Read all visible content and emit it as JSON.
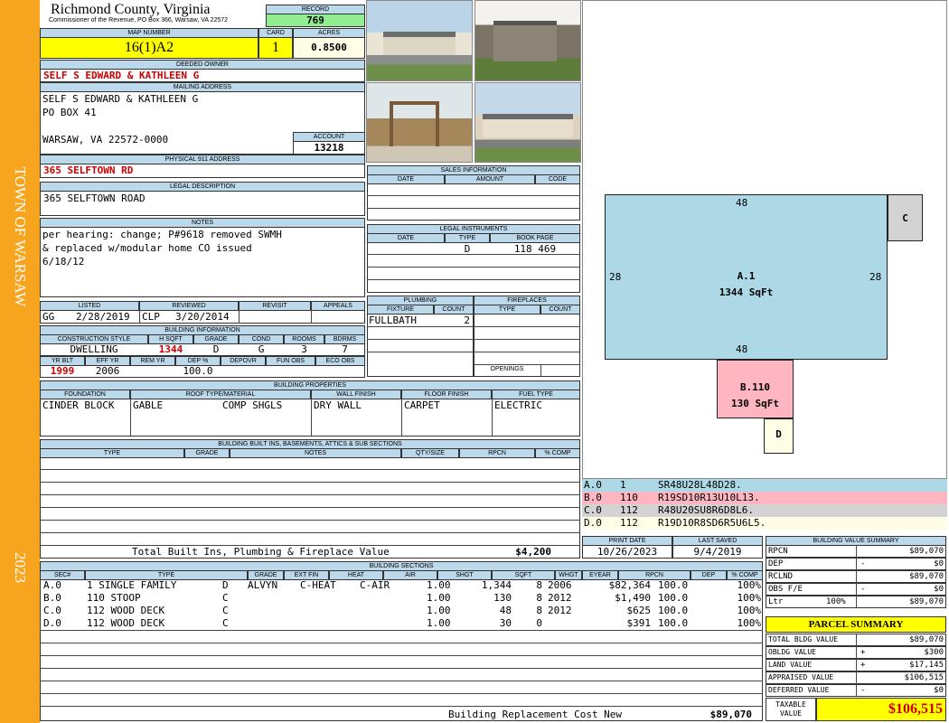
{
  "sidebar": {
    "town": "TOWN OF WARSAW",
    "year": "2023"
  },
  "header": {
    "county": "Richmond County, Virginia",
    "commissioner": "Commissioner of the Revenue, PO Box 366, Warsaw, VA 22572",
    "record_label": "RECORD",
    "record": "769",
    "map_label": "MAP NUMBER",
    "map_number": "16(1)A2",
    "card_label": "CARD",
    "card": "1",
    "acres_label": "ACRES",
    "acres": "0.8500"
  },
  "owner": {
    "deeded_label": "DEEDED OWNER",
    "deeded_owner": "SELF S EDWARD & KATHLEEN G",
    "mailing_label": "MAILING ADDRESS",
    "mail_line1": "SELF S EDWARD & KATHLEEN G",
    "mail_line2": "PO BOX 41",
    "mail_line3": "WARSAW, VA 22572-0000",
    "account_label": "ACCOUNT",
    "account": "13218",
    "physical_label": "PHYSICAL 911 ADDRESS",
    "physical_address": "365 SELFTOWN RD",
    "legal_label": "LEGAL DESCRIPTION",
    "legal_description": "365 SELFTOWN ROAD",
    "notes_label": "NOTES",
    "notes_line1": "per hearing: change; P#9618 removed SWMH",
    "notes_line2": "& replaced w/modular home CO issued",
    "notes_line3": "6/18/12"
  },
  "review": {
    "listed_label": "LISTED",
    "reviewed_label": "REVIEWED",
    "revisit_label": "REVISIT",
    "appeals_label": "APPEALS",
    "listed_by": "GG",
    "listed_date": "2/28/2019",
    "reviewed_by": "CLP",
    "reviewed_date": "3/20/2014"
  },
  "building_info": {
    "title": "BUILDING INFORMATION",
    "h_construction": "CONSTRUCTION STYLE",
    "h_sqft": "H SQFT",
    "h_grade": "GRADE",
    "h_cond": "COND",
    "h_rooms": "ROOMS",
    "h_bdrms": "BDRMS",
    "construction": "DWELLING",
    "sqft": "1344",
    "grade": "D",
    "cond": "G",
    "rooms": "3",
    "bdrms": "7",
    "h_yrblt": "YR BLT",
    "h_effyr": "EFF YR",
    "h_remyr": "REM YR",
    "h_dep": "DEP %",
    "h_depovr": "DEPOVR",
    "h_funobs": "FUN OBS",
    "h_ecoobs": "ECO OBS",
    "yr_blt": "1999",
    "eff_yr": "2006",
    "dep": "100.0"
  },
  "sales": {
    "title": "SALES INFORMATION",
    "h_date": "DATE",
    "h_amount": "AMOUNT",
    "h_code": "CODE"
  },
  "legal_instruments": {
    "title": "LEGAL INSTRUMENTS",
    "h_date": "DATE",
    "h_type": "TYPE",
    "h_book": "BOOK PAGE",
    "type": "D",
    "book_page": "118  469"
  },
  "plumbing": {
    "title": "PLUMBING",
    "h_fixture": "FIXTURE",
    "h_count": "COUNT",
    "fixture": "FULLBATH",
    "count": "2"
  },
  "fireplaces": {
    "title": "FIREPLACES",
    "h_type": "TYPE",
    "h_count": "COUNT",
    "openings": "OPENINGS"
  },
  "properties": {
    "title": "BUILDING PROPERTIES",
    "h_foundation": "FOUNDATION",
    "h_roof": "ROOF TYPE/MATERIAL",
    "h_wall": "WALL FINISH",
    "h_floor": "FLOOR FINISH",
    "h_fuel": "FUEL TYPE",
    "foundation": "CINDER BLOCK",
    "roof_type": "GABLE",
    "roof_material": "COMP SHGLS",
    "wall": "DRY WALL",
    "floor": "CARPET",
    "fuel": "ELECTRIC"
  },
  "builtins": {
    "title": "BUILDING BUILT INS, BASEMENTS, ATTICS & SUB SECTIONS",
    "h_type": "TYPE",
    "h_grade": "GRADE",
    "h_notes": "NOTES",
    "h_qty": "QTY/SIZE",
    "h_rpcn": "RPCN",
    "h_comp": "% COMP",
    "total_label": "Total Built Ins, Plumbing & Fireplace Value",
    "total": "$4,200"
  },
  "print": {
    "h_print": "PRINT DATE",
    "h_saved": "LAST SAVED",
    "print_date": "10/26/2023",
    "last_saved": "9/4/2019"
  },
  "sections": {
    "title": "BUILDING SECTIONS",
    "headers": [
      "SEC#",
      "TYPE",
      "GRADE",
      "EXT FIN",
      "HEAT",
      "AIR",
      "SHGT",
      "SQFT",
      "WHGT",
      "EYEAR",
      "RPCN",
      "DEP",
      "% COMP"
    ],
    "rows": [
      [
        "A.0",
        "1 SINGLE FAMILY",
        "D",
        "ALVYN",
        "C-HEAT",
        "C-AIR",
        "1.00",
        "1,344",
        "8",
        "2006",
        "$82,364",
        "100.0",
        "100%"
      ],
      [
        "B.0",
        "110 STOOP",
        "C",
        "",
        "",
        "",
        "1.00",
        "130",
        "8",
        "2012",
        "$1,490",
        "100.0",
        "100%"
      ],
      [
        "C.0",
        "112 WOOD DECK",
        "C",
        "",
        "",
        "",
        "1.00",
        "48",
        "8",
        "2012",
        "$625",
        "100.0",
        "100%"
      ],
      [
        "D.0",
        "112 WOOD DECK",
        "C",
        "",
        "",
        "",
        "1.00",
        "30",
        "0",
        "",
        "$391",
        "100.0",
        "100%"
      ]
    ],
    "replacement_label": "Building Replacement Cost New",
    "replacement": "$89,070"
  },
  "sketch": {
    "a_label": "A.1",
    "a_area": "1344 SqFt",
    "a_top": "48",
    "a_bottom": "48",
    "a_left": "28",
    "a_right": "28",
    "b_label": "B.110",
    "b_area": "130 SqFt",
    "c_label": "C",
    "d_label": "D",
    "colors": {
      "a": "#add8e6",
      "b": "#ffb6c1",
      "c": "#d3d3d3",
      "d": "#fffde6"
    },
    "legend": [
      {
        "sec": "A.0",
        "code": "1",
        "path": "SR48U28L48D28."
      },
      {
        "sec": "B.0",
        "code": "110",
        "path": "R19SD10R13U10L13."
      },
      {
        "sec": "C.0",
        "code": "112",
        "path": "R48U20SU8R6D8L6."
      },
      {
        "sec": "D.0",
        "code": "112",
        "path": "R19D10R8SD6R5U6L5."
      }
    ]
  },
  "bvs": {
    "title": "BUILDING VALUE SUMMARY",
    "rpcn_label": "RPCN",
    "rpcn": "$89,070",
    "dep_label": "DEP",
    "dep_sign": "-",
    "dep": "$0",
    "rclnd_label": "RCLND",
    "rclnd": "$89,070",
    "obs_label": "OBS F/E",
    "obs_sign": "-",
    "obs": "$0",
    "ltr_label": "Ltr",
    "ltr_pct": "100%",
    "ltr": "$89,070"
  },
  "parcel": {
    "title": "PARCEL SUMMARY",
    "bldg_label": "TOTAL BLDG VALUE",
    "bldg": "$89,070",
    "obldg_label": "OBLDG VALUE",
    "obldg_sign": "+",
    "obldg": "$300",
    "land_label": "LAND VALUE",
    "land_sign": "+",
    "land": "$17,145",
    "appraised_label": "APPRAISED VALUE",
    "appraised": "$106,515",
    "deferred_label": "DEFERRED VALUE",
    "deferred_sign": "-",
    "deferred": "$0",
    "taxable_label1": "TAXABLE",
    "taxable_label2": "VALUE",
    "taxable": "$106,515"
  }
}
